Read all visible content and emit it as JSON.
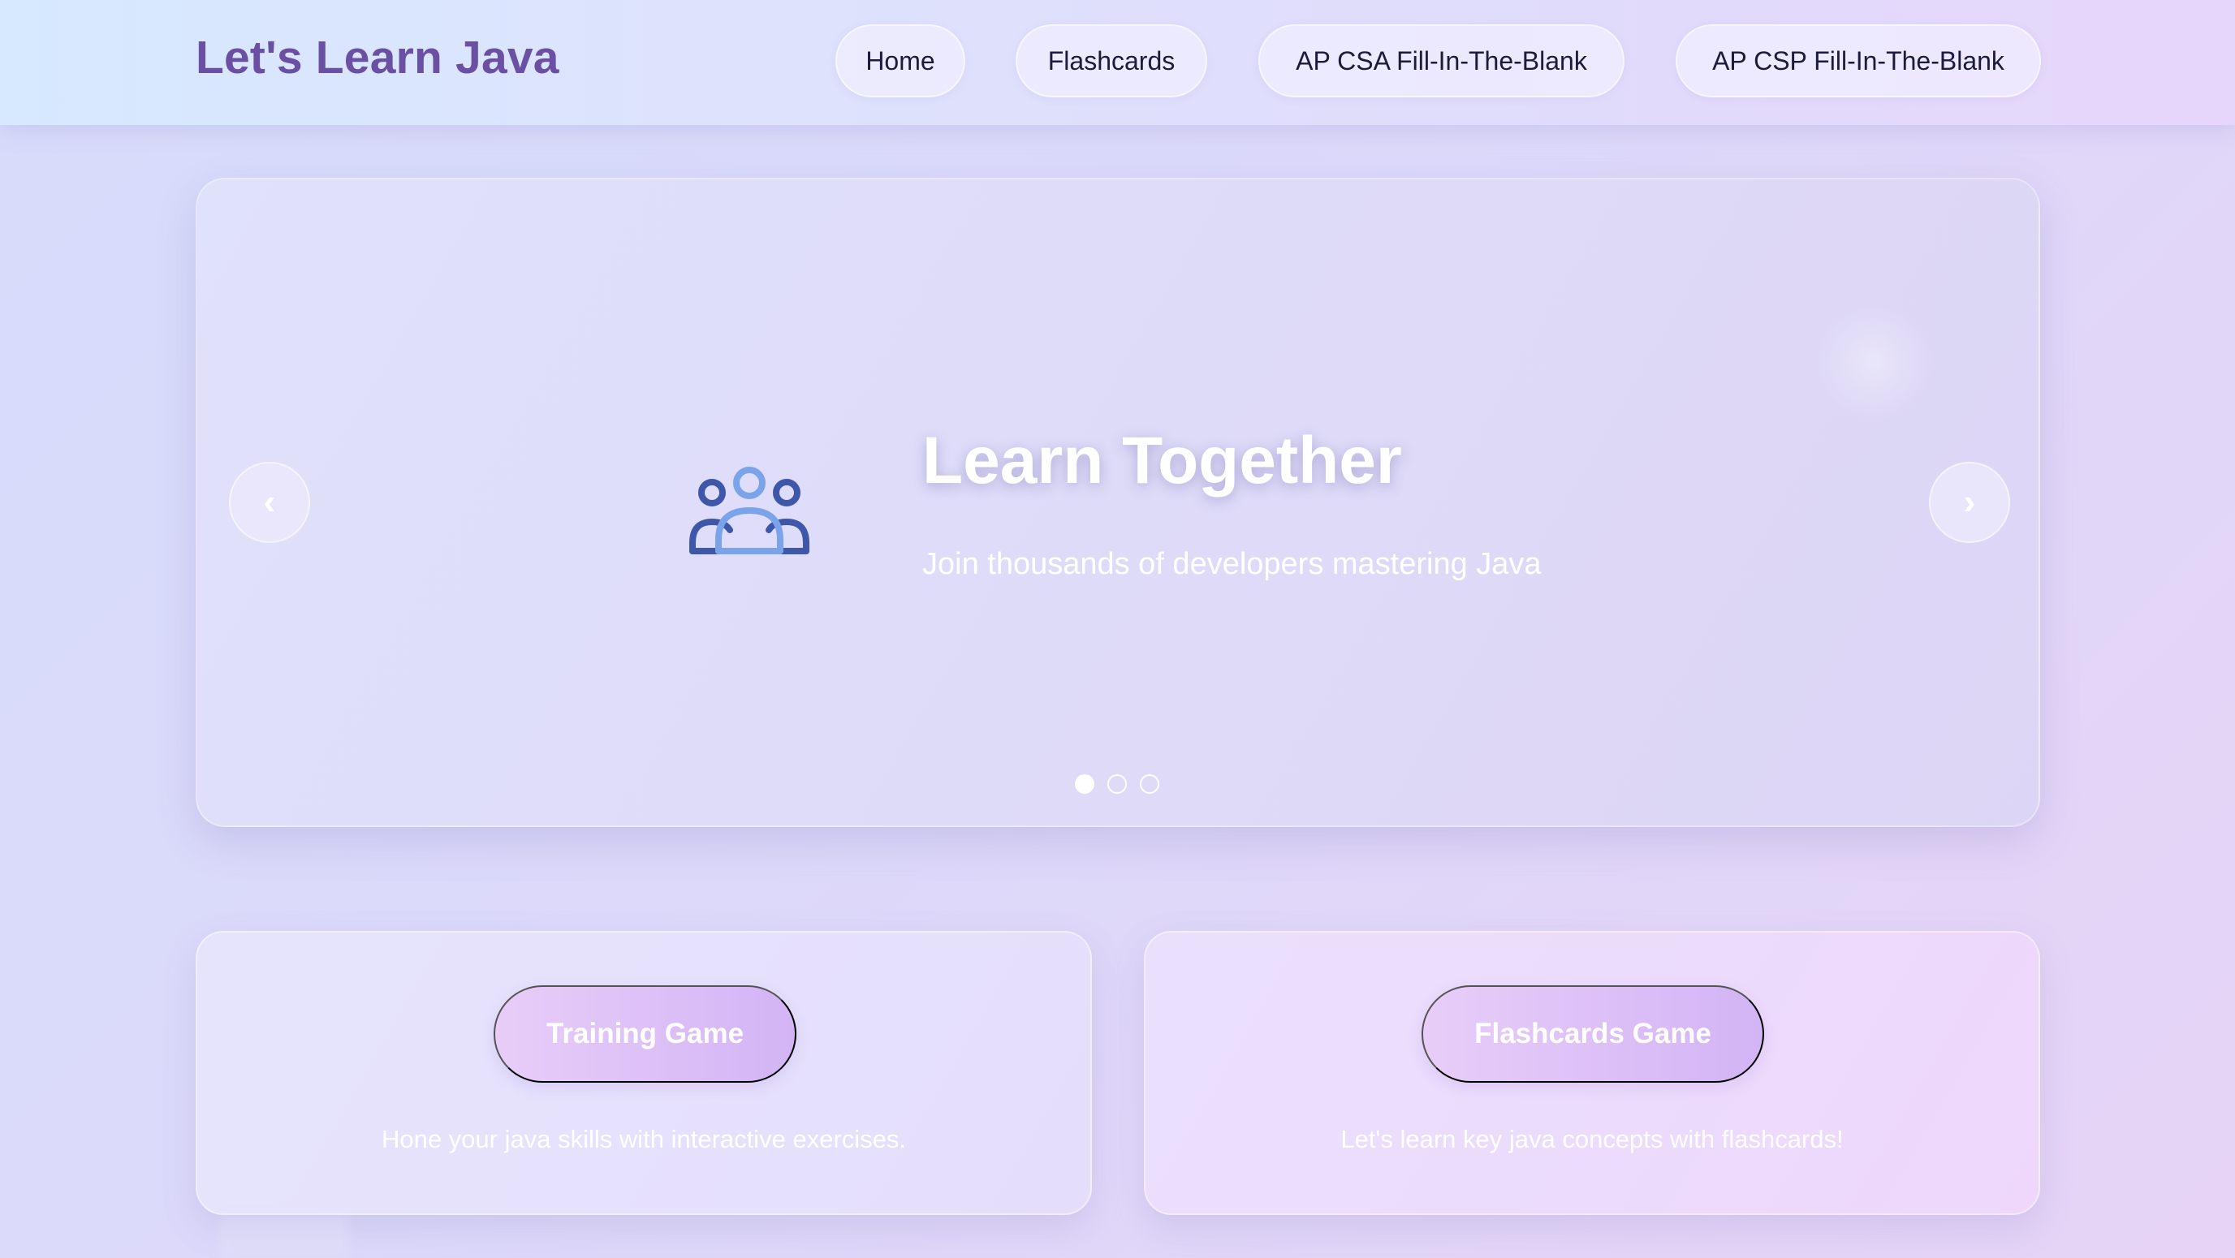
{
  "header": {
    "logo": "Let's Learn Java",
    "nav": [
      {
        "label": "Home"
      },
      {
        "label": "Flashcards"
      },
      {
        "label": "AP CSA Fill-In-The-Blank"
      },
      {
        "label": "AP CSP Fill-In-The-Blank"
      }
    ]
  },
  "hero": {
    "icon": "users-group-icon",
    "title": "Learn Together",
    "subtitle": "Join thousands of developers mastering Java",
    "prev_label": "‹",
    "next_label": "›",
    "slide_count": 3,
    "active_slide": 1
  },
  "cards": [
    {
      "button_label": "Training Game",
      "description": "Hone your java skills with interactive exercises."
    },
    {
      "button_label": "Flashcards Game",
      "description": "Let's learn key java concepts with flashcards!"
    }
  ],
  "colors": {
    "logo": "#6a4fa2",
    "nav_text": "#1d1b3c",
    "icon_dark": "#3f57a8",
    "icon_light": "#7aa3ea",
    "button_gradient_start": "#e8cdf8",
    "button_gradient_end": "#d3b4f5"
  }
}
